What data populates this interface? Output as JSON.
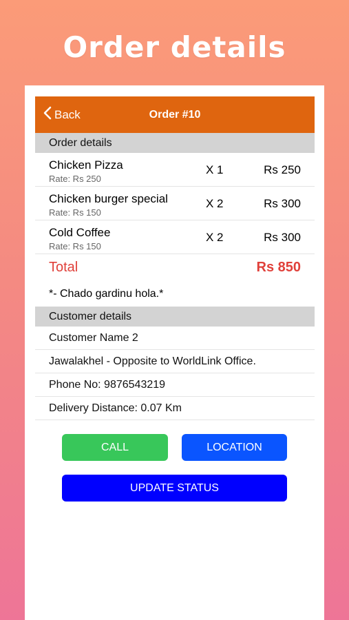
{
  "promo": {
    "title": "Order details"
  },
  "navbar": {
    "back_label": "Back",
    "title": "Order #10"
  },
  "order_section": {
    "header": "Order details"
  },
  "items": [
    {
      "name": "Chicken Pizza",
      "rate": "Rate: Rs 250",
      "qty": "X 1",
      "price": "Rs 250"
    },
    {
      "name": "Chicken burger special",
      "rate": "Rate: Rs 150",
      "qty": "X 2",
      "price": "Rs 300"
    },
    {
      "name": "Cold Coffee",
      "rate": "Rate: Rs 150",
      "qty": "X 2",
      "price": "Rs 300"
    }
  ],
  "total": {
    "label": "Total",
    "value": "Rs 850"
  },
  "note": "*- Chado gardinu hola.*",
  "customer_section": {
    "header": "Customer details",
    "name": "Customer Name 2",
    "address": "Jawalakhel - Opposite to WorldLink Office.",
    "phone": "Phone No: 9876543219",
    "distance": "Delivery Distance: 0.07 Km"
  },
  "buttons": {
    "call": "CALL",
    "location": "LOCATION",
    "update_status": "UPDATE STATUS"
  },
  "colors": {
    "navbar": "#df650f",
    "total": "#e0403a",
    "call_button": "#38c75a",
    "location_button": "#0a55ff",
    "update_button": "#0000ff"
  }
}
